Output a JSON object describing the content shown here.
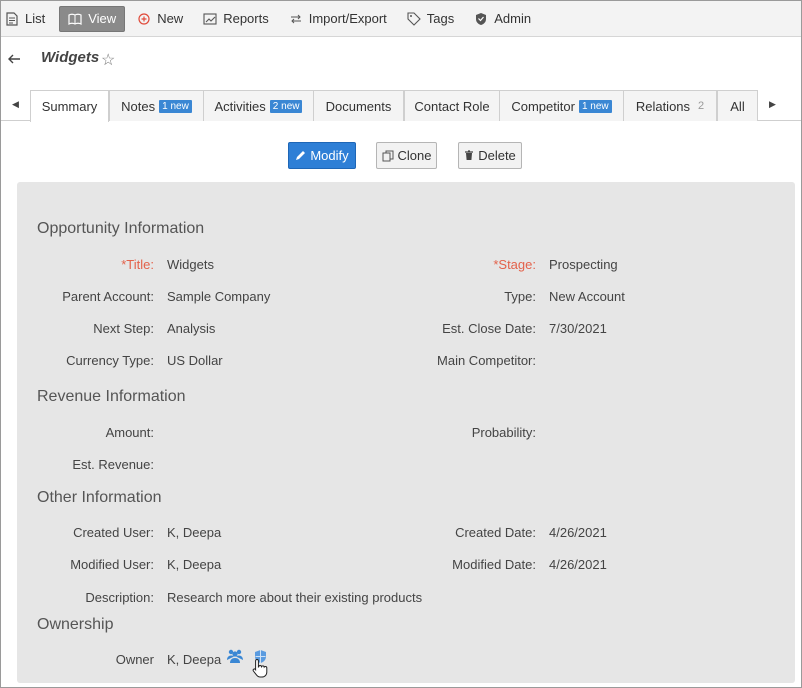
{
  "toolbar": {
    "list": "List",
    "view": "View",
    "new": "New",
    "reports": "Reports",
    "import_export": "Import/Export",
    "tags": "Tags",
    "admin": "Admin"
  },
  "header": {
    "title": "Widgets"
  },
  "tabs": [
    {
      "label": "Summary"
    },
    {
      "label": "Notes",
      "badge": "1 new"
    },
    {
      "label": "Activities",
      "badge": "2 new"
    },
    {
      "label": "Documents"
    },
    {
      "label": "Contact Role"
    },
    {
      "label": "Competitor",
      "badge": "1 new"
    },
    {
      "label": "Relations",
      "count": "2"
    },
    {
      "label": "All"
    }
  ],
  "actions": {
    "modify": "Modify",
    "clone": "Clone",
    "delete": "Delete"
  },
  "sections": {
    "opportunity": {
      "title": "Opportunity Information",
      "title_label": "*Title:",
      "title_value": "Widgets",
      "stage_label": "*Stage:",
      "stage_value": "Prospecting",
      "parent_label": "Parent Account:",
      "parent_value": "Sample Company",
      "type_label": "Type:",
      "type_value": "New Account",
      "next_step_label": "Next Step:",
      "next_step_value": "Analysis",
      "close_date_label": "Est. Close Date:",
      "close_date_value": "7/30/2021",
      "currency_label": "Currency Type:",
      "currency_value": "US Dollar",
      "competitor_label": "Main Competitor:",
      "competitor_value": ""
    },
    "revenue": {
      "title": "Revenue Information",
      "amount_label": "Amount:",
      "amount_value": "",
      "probability_label": "Probability:",
      "probability_value": "",
      "est_revenue_label": "Est. Revenue:",
      "est_revenue_value": ""
    },
    "other": {
      "title": "Other Information",
      "created_user_label": "Created User:",
      "created_user_value": "K, Deepa",
      "created_date_label": "Created Date:",
      "created_date_value": "4/26/2021",
      "modified_user_label": "Modified User:",
      "modified_user_value": "K, Deepa",
      "modified_date_label": "Modified Date:",
      "modified_date_value": "4/26/2021",
      "description_label": "Description:",
      "description_value": "Research more about their existing products"
    },
    "ownership": {
      "title": "Ownership",
      "owner_label": "Owner",
      "owner_value": "K, Deepa"
    }
  },
  "colors": {
    "accent": "#2e7fd6",
    "required": "#e3624b",
    "panel": "#e6e6e6",
    "badge": "#3a87d4"
  }
}
